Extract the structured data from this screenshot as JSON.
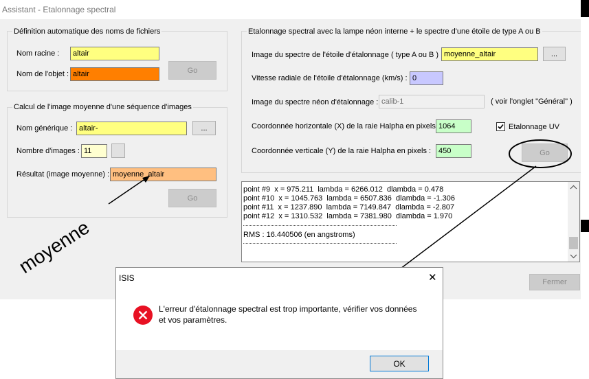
{
  "window": {
    "title": "Assistant - Etalonnage spectral"
  },
  "group_names": {
    "title": "Définition automatique des noms de fichiers",
    "root_label": "Nom racine :",
    "root_value": "altair",
    "object_label": "Nom de l'objet :",
    "object_value": "altair",
    "go_label": "Go"
  },
  "group_average": {
    "title": "Calcul de l'image moyenne d'une séquence d'images",
    "generic_label": "Nom générique :",
    "generic_value": "altair-",
    "browse_label": "...",
    "count_label": "Nombre d'images :",
    "count_value": "11",
    "result_label": "Résultat (image moyenne) :",
    "result_value": "moyenne_altair",
    "go_label": "Go"
  },
  "group_calibration": {
    "title": "Etalonnage spectral avec la lampe néon interne + le spectre d'une étoile de type A ou B",
    "star_image_label": "Image du spectre de l'étoile d'étalonnage ( type A ou B ) :",
    "star_image_value": "moyenne_altair",
    "browse_label": "...",
    "radial_label": "Vitesse radiale de l'étoile d'étalonnage (km/s) :",
    "radial_value": "0",
    "neon_label": "Image du spectre néon d'étalonnage :",
    "neon_value": "calib-1",
    "neon_note": "( voir l'onglet \"Général\" )",
    "x_label": "Coordonnée horizontale (X) de la raie Halpha en pixels :",
    "x_value": "1064",
    "y_label": "Coordonnée verticale (Y) de la raie Halpha en pixels :",
    "y_value": "450",
    "uv_label": "Etalonnage UV",
    "uv_checked": true,
    "go_label": "Go"
  },
  "log": {
    "lines": [
      "point #9  x = 975.211  lambda = 6266.012  dlambda = 0.478",
      "point #10  x = 1045.763  lambda = 6507.836  dlambda = -1.306",
      "point #11  x = 1237.890  lambda = 7149.847  dlambda = -2.807",
      "point #12  x = 1310.532  lambda = 7381.980  dlambda = 1.970"
    ],
    "rms": "RMS : 16.440506 (en angstroms)"
  },
  "close_label": "Fermer",
  "annotation": {
    "text": "moyenne"
  },
  "dialog": {
    "title": "ISIS",
    "close_glyph": "✕",
    "message_line1": "L'erreur d'étalonnage spectral est trop importante, vérifier vos données",
    "message_line2": "et vos paramètres.",
    "ok_label": "OK"
  },
  "colors": {
    "yellow_field": "#ffff80",
    "orange_field": "#ff7f00",
    "peach_field": "#ffbf80",
    "error_red": "#e81123"
  }
}
